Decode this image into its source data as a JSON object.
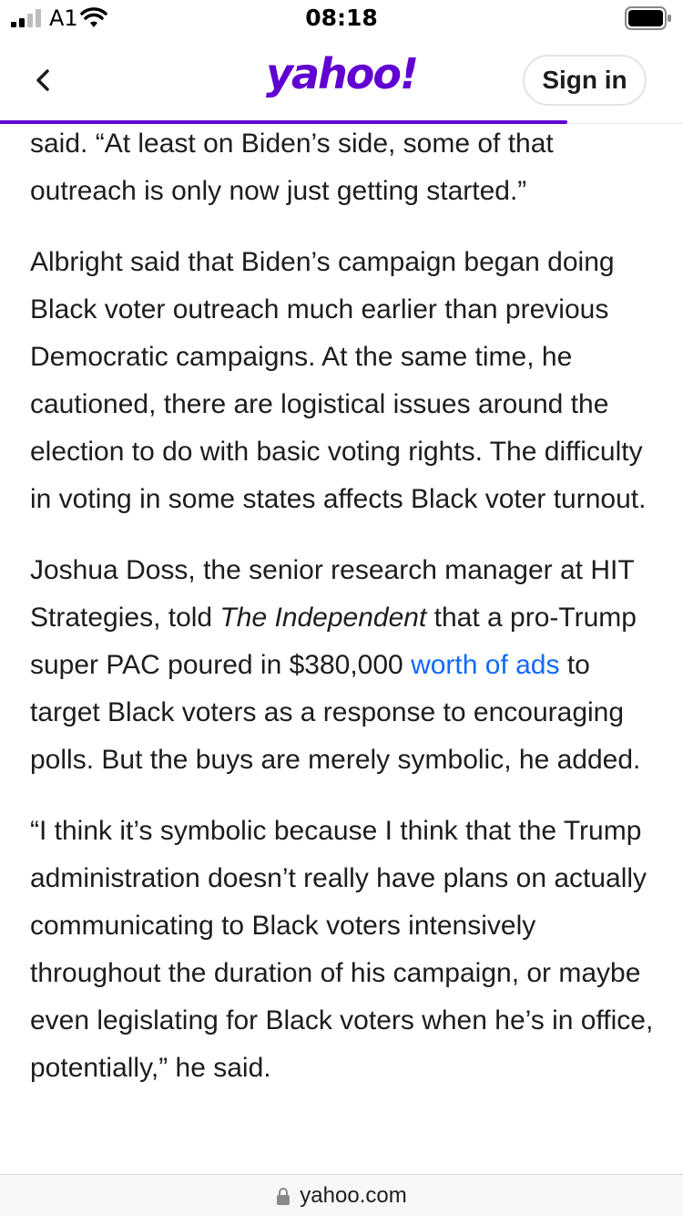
{
  "status_bar": {
    "carrier": "A1",
    "time": "08:18"
  },
  "header": {
    "logo": "yahoo!",
    "sign_in_label": "Sign in",
    "brand_color": "#6001d2",
    "read_progress_percent": 83
  },
  "article": {
    "p1": "said. “At least on Biden’s side, some of that outreach is only now just getting started.”",
    "p2": "Albright said that Biden’s campaign began doing Black voter outreach much earlier than previous Democratic campaigns. At the same time, he cautioned, there are logistical issues around the election to do with basic voting rights. The difficulty in voting in some states affects Black voter turnout.",
    "p3_a": "Joshua Doss, the senior research manager at HIT Strategies, told ",
    "p3_em": "The Independent",
    "p3_b": " that a pro-Trump super PAC poured in $380,000 ",
    "p3_link": "worth of ads",
    "p3_c": " to target Black voters as a response to encouraging polls. But the buys are merely symbolic, he added.",
    "p4": "“I think it’s symbolic because I think that the Trump administration doesn’t really have plans on actually communicating to Black voters intensively throughout the duration of his campaign, or maybe even legislating for Black voters when he’s in office, potentially,” he said.",
    "link_color": "#0f69ff"
  },
  "url_bar": {
    "domain": "yahoo.com"
  }
}
